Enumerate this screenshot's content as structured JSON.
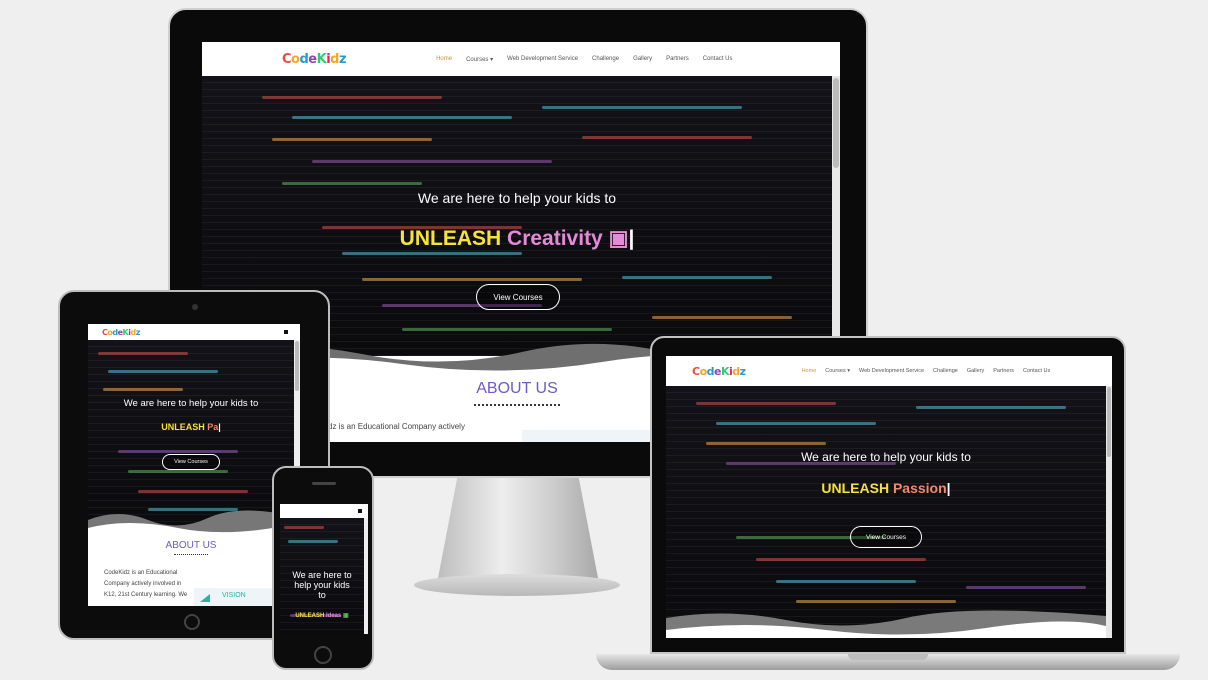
{
  "site": {
    "logo_text": [
      "C",
      "o",
      "d",
      "e",
      "K",
      "i",
      "d",
      "z"
    ]
  },
  "nav": {
    "items": [
      "Home",
      "Courses",
      "Web Development Service",
      "Challenge",
      "Gallery",
      "Partners",
      "Contact Us"
    ]
  },
  "hero": {
    "headline": "We are here to help your kids to",
    "headline_split_1": "We are here to",
    "headline_split_2": "help your kids",
    "headline_split_3": "to",
    "unleash": "UNLEASH",
    "desktop_word": "Creativity",
    "laptop_word": "Passion",
    "tablet_word": "Pa",
    "phone_word": "Ideas",
    "cta": "View Courses"
  },
  "about": {
    "title": "ABOUT US",
    "desktop_snippet": "dz is an Educational Company actively",
    "tablet_lines": [
      "CodeKidz is an Educational",
      "Company actively involved in",
      "K12, 21st Century learning. We"
    ],
    "vision_label": "VISION"
  },
  "colors": {
    "accent_purple": "#6d59c9",
    "unleash_yellow": "#f5e23a",
    "word_pink": "#e48ad6",
    "nav_active": "#c7943e"
  }
}
